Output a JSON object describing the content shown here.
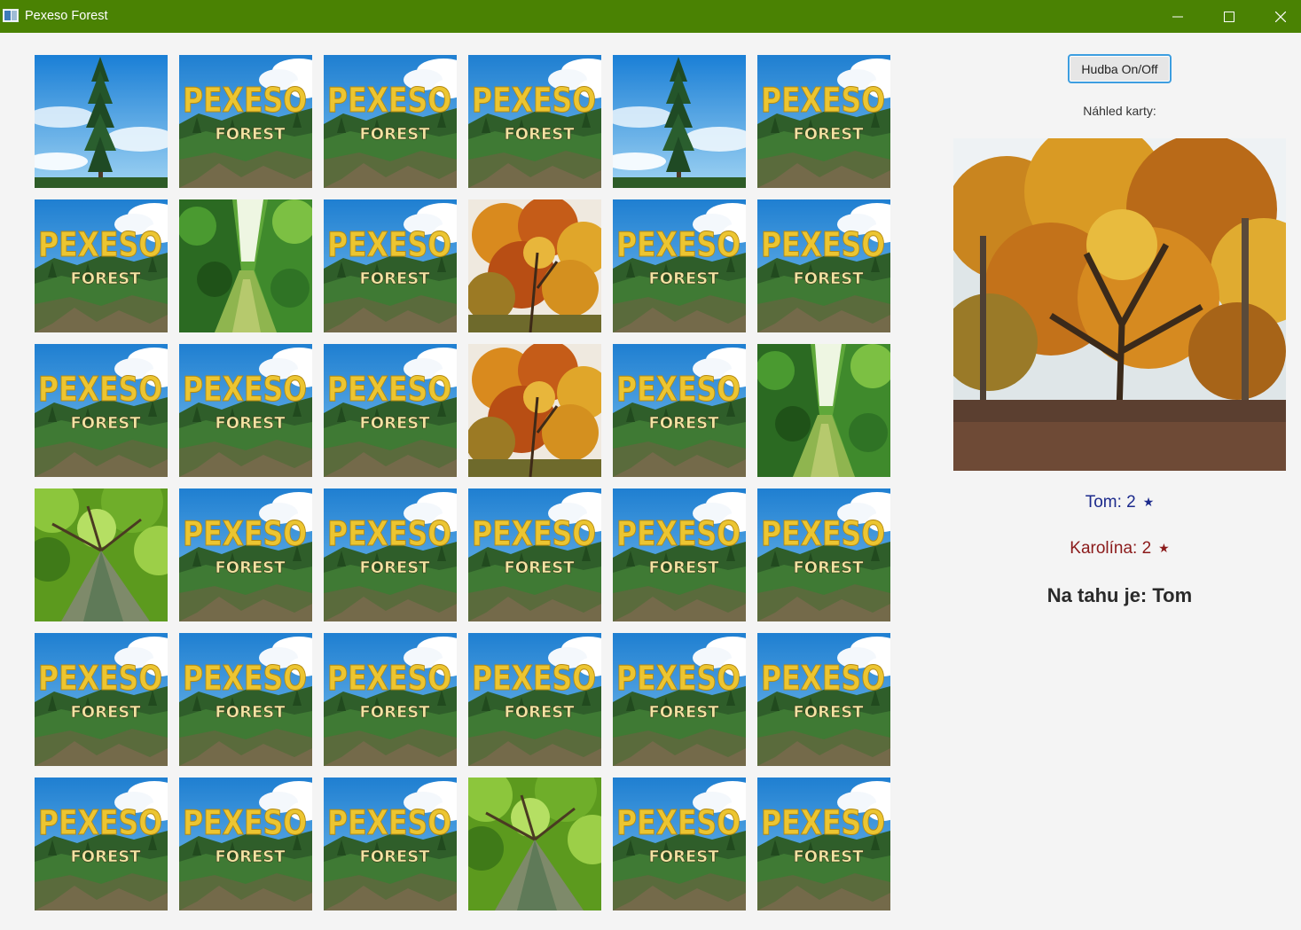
{
  "window": {
    "title": "Pexeso Forest",
    "controls": [
      "minimize",
      "maximize",
      "close"
    ]
  },
  "board": {
    "rows": 6,
    "columns": 6,
    "card_back_text": {
      "word1": "PEXESO",
      "word2": "FOREST"
    },
    "cards": [
      "tall-tree",
      "back",
      "back",
      "back",
      "tall-tree",
      "back",
      "back",
      "forest-path",
      "back",
      "autumn-tree",
      "back",
      "back",
      "back",
      "back",
      "back",
      "autumn-tree",
      "back",
      "forest-path",
      "trunk-up",
      "back",
      "back",
      "back",
      "back",
      "back",
      "back",
      "back",
      "back",
      "back",
      "back",
      "back",
      "back",
      "back",
      "back",
      "trunk-up",
      "back",
      "back"
    ]
  },
  "panel": {
    "music_button": "Hudba On/Off",
    "preview_label": "Náhled karty:",
    "preview_image": "autumn-forest",
    "players": [
      {
        "label": "Tom: 2",
        "icon": "star-icon",
        "color": "#1c2a8c"
      },
      {
        "label": "Karolína: 2",
        "icon": "star-icon",
        "color": "#8b1a1a"
      }
    ],
    "turn_text": "Na tahu je: Tom"
  }
}
